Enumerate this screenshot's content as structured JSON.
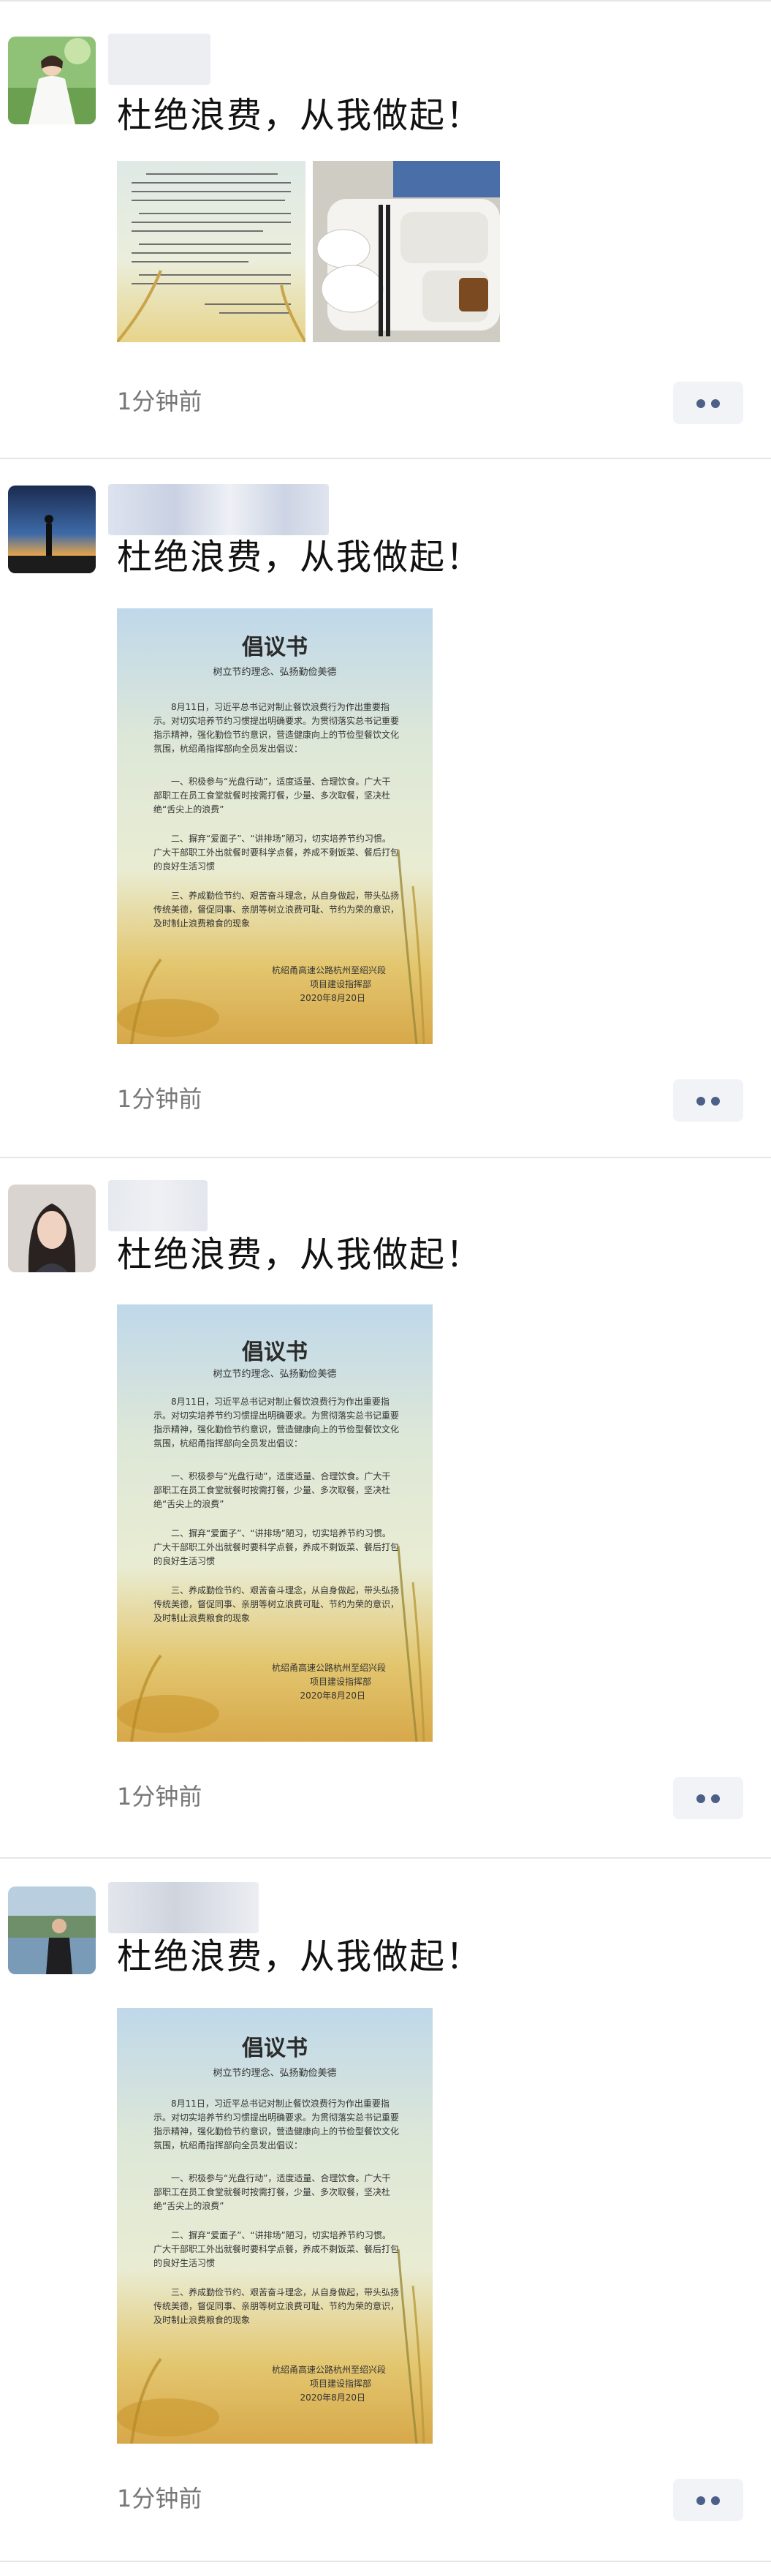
{
  "posts": [
    {
      "text": "杜绝浪费，从我做起！",
      "time": "1分钟前",
      "avatar": "woman-in-white-dress-avatar",
      "images": [
        "letter-photo",
        "cafeteria-tray-photo"
      ]
    },
    {
      "text": "杜绝浪费，从我做起！",
      "time": "1分钟前",
      "avatar": "sunset-silhouette-avatar",
      "images": [
        "proposal-letter"
      ]
    },
    {
      "text": "杜绝浪费，从我做起！",
      "time": "1分钟前",
      "avatar": "woman-portrait-avatar",
      "images": [
        "proposal-letter"
      ]
    },
    {
      "text": "杜绝浪费，从我做起！",
      "time": "1分钟前",
      "avatar": "man-by-lake-avatar",
      "images": [
        "proposal-letter"
      ]
    }
  ],
  "letter": {
    "title": "倡议书",
    "subtitle": "树立节约理念、弘扬勤俭美德",
    "intro": "8月11日，习近平总书记对制止餐饮浪费行为作出重要指示。对切实培养节约习惯提出明确要求。为贯彻落实总书记重要指示精神，强化勤俭节约意识，营造健康向上的节俭型餐饮文化氛围，杭绍甬指挥部向全员发出倡议：",
    "item1": "一、积极参与“光盘行动”，适度适量、合理饮食。广大干部职工在员工食堂就餐时按需打餐，少量、多次取餐，坚决杜绝“舌尖上的浪费”",
    "item2": "二、摒弃“爱面子”、“讲排场”陋习，切实培养节约习惯。广大干部职工外出就餐时要科学点餐，养成不剩饭菜、餐后打包的良好生活习惯",
    "item3": "三、养成勤俭节约、艰苦奋斗理念，从自身做起，带头弘扬传统美德，督促同事、亲朋等树立浪费可耻、节约为荣的意识，及时制止浪费粮食的现象",
    "sign_org": "杭绍甬高速公路杭州至绍兴段",
    "sign_dept": "项目建设指挥部",
    "sign_date": "2020年8月20日"
  },
  "colors": {
    "time": "#777777",
    "more_bg": "#f1f3f7",
    "more_dot": "#4c5f86",
    "divider": "#e6e6e6"
  }
}
